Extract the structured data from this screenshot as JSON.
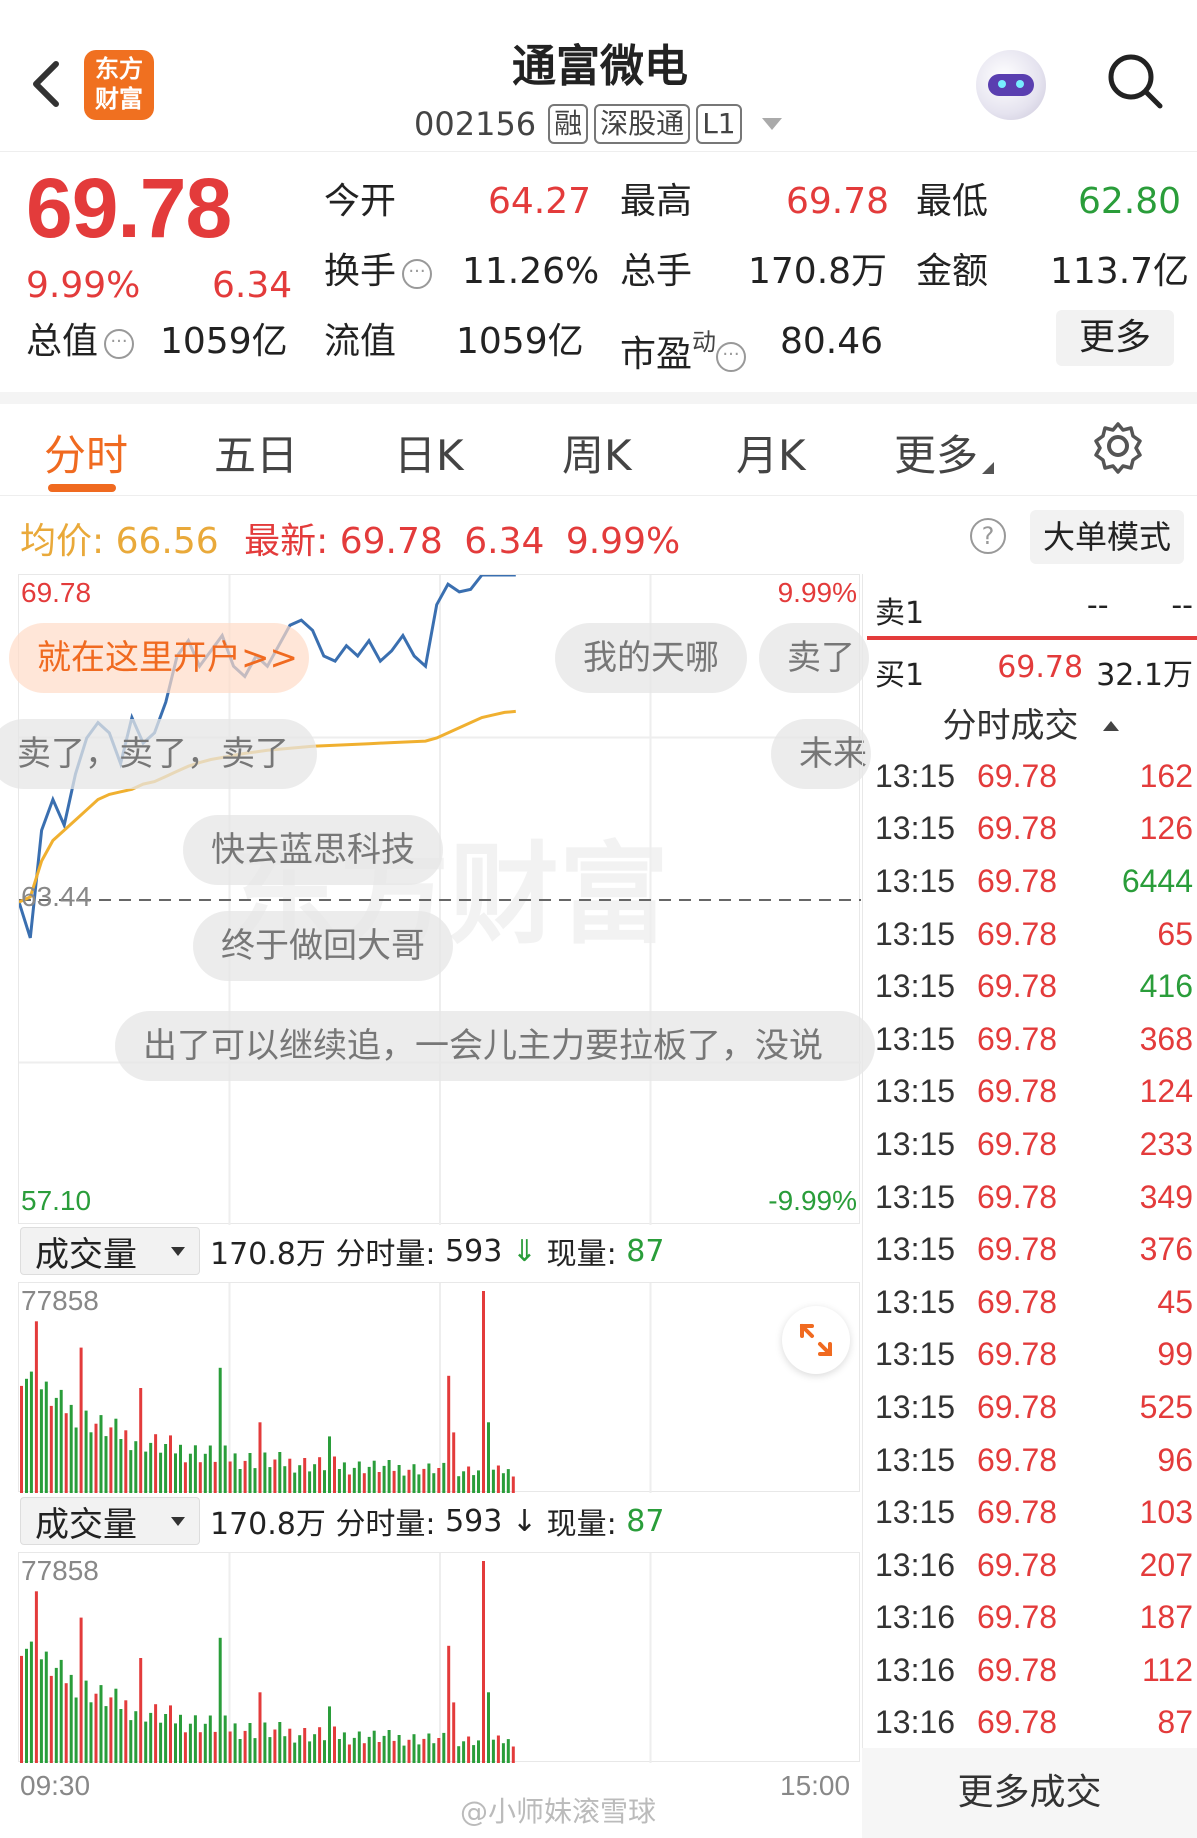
{
  "header": {
    "logo_text": "东方财富",
    "title": "通富微电",
    "code": "002156",
    "tags": [
      "融",
      "深股通",
      "L1"
    ]
  },
  "quote": {
    "price": "69.78",
    "change_pct": "9.99%",
    "change": "6.34",
    "open_label": "今开",
    "open": "64.27",
    "high_label": "最高",
    "high": "69.78",
    "low_label": "最低",
    "low": "62.80",
    "turnover_label": "换手",
    "turnover": "11.26%",
    "volume_label": "总手",
    "volume": "170.8万",
    "amount_label": "金额",
    "amount": "113.7亿",
    "mcap_label": "总值",
    "mcap": "1059亿",
    "float_label": "流值",
    "float": "1059亿",
    "pe_label": "市盈",
    "pe_sup": "动",
    "pe": "80.46",
    "more_label": "更多"
  },
  "tabs": [
    "分时",
    "五日",
    "日K",
    "周K",
    "月K",
    "更多"
  ],
  "infoline": {
    "avg_label": "均价:",
    "avg": "66.56",
    "last_label": "最新:",
    "last": "69.78",
    "chg": "6.34",
    "pct": "9.99%",
    "big_order_mode": "大单模式"
  },
  "chart_axes": {
    "top_price": "69.78",
    "top_pct": "9.99%",
    "mid_price": "63.44",
    "bottom_price": "57.10",
    "bottom_pct": "-9.99%",
    "vol_max": "77858",
    "time_start": "09:30",
    "time_end": "15:00"
  },
  "volume_bar": {
    "selector": "成交量",
    "total": "170.8万",
    "period_label": "分时量:",
    "period_val": "593",
    "period_arrow_top": "⇓",
    "period_arrow_bottom": "↓",
    "now_label": "现量:",
    "now_val": "87"
  },
  "bubbles": [
    "就在这里开户>>",
    "我的天哪",
    "卖了",
    "卖了，卖了，卖了",
    "未来",
    "快去蓝思科技",
    "终于做回大哥",
    "出了可以继续追，一会儿主力要拉板了，没说"
  ],
  "orderbook": {
    "sell1_label": "卖1",
    "sell1_price": "--",
    "sell1_vol": "--",
    "buy1_label": "买1",
    "buy1_price": "69.78",
    "buy1_vol": "32.1万"
  },
  "trades_title": "分时成交",
  "trades": [
    {
      "time": "13:15",
      "price": "69.78",
      "vol": "162",
      "dir": "red"
    },
    {
      "time": "13:15",
      "price": "69.78",
      "vol": "126",
      "dir": "red"
    },
    {
      "time": "13:15",
      "price": "69.78",
      "vol": "6444",
      "dir": "green"
    },
    {
      "time": "13:15",
      "price": "69.78",
      "vol": "65",
      "dir": "red"
    },
    {
      "time": "13:15",
      "price": "69.78",
      "vol": "416",
      "dir": "green"
    },
    {
      "time": "13:15",
      "price": "69.78",
      "vol": "368",
      "dir": "red"
    },
    {
      "time": "13:15",
      "price": "69.78",
      "vol": "124",
      "dir": "red"
    },
    {
      "time": "13:15",
      "price": "69.78",
      "vol": "233",
      "dir": "red"
    },
    {
      "time": "13:15",
      "price": "69.78",
      "vol": "349",
      "dir": "red"
    },
    {
      "time": "13:15",
      "price": "69.78",
      "vol": "376",
      "dir": "red"
    },
    {
      "time": "13:15",
      "price": "69.78",
      "vol": "45",
      "dir": "red"
    },
    {
      "time": "13:15",
      "price": "69.78",
      "vol": "99",
      "dir": "red"
    },
    {
      "time": "13:15",
      "price": "69.78",
      "vol": "525",
      "dir": "red"
    },
    {
      "time": "13:15",
      "price": "69.78",
      "vol": "96",
      "dir": "red"
    },
    {
      "time": "13:15",
      "price": "69.78",
      "vol": "103",
      "dir": "red"
    },
    {
      "time": "13:16",
      "price": "69.78",
      "vol": "207",
      "dir": "red"
    },
    {
      "time": "13:16",
      "price": "69.78",
      "vol": "187",
      "dir": "red"
    },
    {
      "time": "13:16",
      "price": "69.78",
      "vol": "112",
      "dir": "red"
    },
    {
      "time": "13:16",
      "price": "69.78",
      "vol": "87",
      "dir": "red"
    }
  ],
  "more_trades": "更多成交",
  "watermark": "@小师妹滚雪球",
  "chart_watermark": "东方财富",
  "colors": {
    "up": "#e33b3b",
    "down": "#2a9d3a",
    "price_line": "#3a6fb0",
    "avg_line": "#f0b030",
    "accent": "#f06a20"
  },
  "chart_data": {
    "type": "line",
    "title": "",
    "prev_close": 63.44,
    "ylim": [
      57.1,
      69.78
    ],
    "series": [
      {
        "values": [
          63.4,
          62.7,
          64.8,
          65.4,
          64.9,
          65.9,
          66.6,
          66.9,
          66.7,
          66.1,
          67.0,
          66.5,
          66.7,
          67.3,
          68.2,
          68.5,
          68.0,
          68.3,
          68.6,
          68.0,
          67.8,
          68.2,
          68.0,
          68.4,
          68.8,
          68.9,
          68.7,
          68.2,
          68.1,
          68.4,
          68.2,
          68.5,
          68.1,
          68.3,
          68.6,
          68.2,
          68.0,
          69.2,
          69.6,
          69.45,
          69.5,
          69.78,
          69.78,
          69.78,
          69.78
        ]
      },
      {
        "values": [
          63.4,
          63.5,
          64.2,
          64.6,
          64.8,
          65.0,
          65.2,
          65.4,
          65.5,
          65.55,
          65.6,
          65.7,
          65.75,
          65.85,
          65.95,
          66.05,
          66.12,
          66.18,
          66.22,
          66.26,
          66.3,
          66.33,
          66.36,
          66.38,
          66.4,
          66.42,
          66.44,
          66.45,
          66.46,
          66.47,
          66.48,
          66.49,
          66.5,
          66.51,
          66.52,
          66.53,
          66.54,
          66.6,
          66.7,
          66.8,
          66.9,
          67.0,
          67.05,
          67.1,
          67.12
        ]
      }
    ],
    "time_end_fraction": 0.59,
    "volume_max": 77858,
    "volume_units": "volume relative to max"
  }
}
